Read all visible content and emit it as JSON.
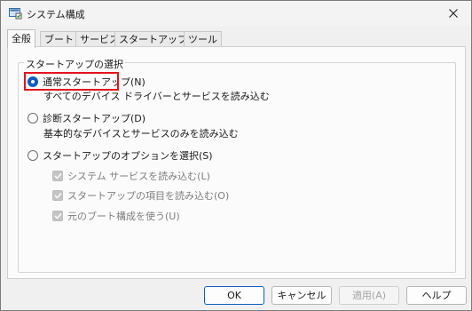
{
  "window": {
    "title": "システム構成"
  },
  "tabs": [
    {
      "label": "全般"
    },
    {
      "label": "ブート"
    },
    {
      "label": "サービス"
    },
    {
      "label": "スタートアップ"
    },
    {
      "label": "ツール"
    }
  ],
  "general": {
    "group_title": "スタートアップの選択",
    "normal": {
      "label": "通常スタートアップ(N)",
      "description": "すべてのデバイス ドライバーとサービスを読み込む",
      "selected": true
    },
    "diagnostic": {
      "label": "診断スタートアップ(D)",
      "description": "基本的なデバイスとサービスのみを読み込む",
      "selected": false
    },
    "selective": {
      "label": "スタートアップのオプションを選択(S)",
      "selected": false,
      "options": [
        {
          "label": "システム サービスを読み込む(L)",
          "checked": true,
          "enabled": false
        },
        {
          "label": "スタートアップの項目を読み込む(O)",
          "checked": true,
          "enabled": false
        },
        {
          "label": "元のブート構成を使う(U)",
          "checked": true,
          "enabled": false
        }
      ]
    }
  },
  "buttons": {
    "ok": "OK",
    "cancel": "キャンセル",
    "apply": "適用(A)",
    "help": "ヘルプ"
  },
  "colors": {
    "accent": "#0f5cc0",
    "highlight_box": "#e1141e"
  }
}
